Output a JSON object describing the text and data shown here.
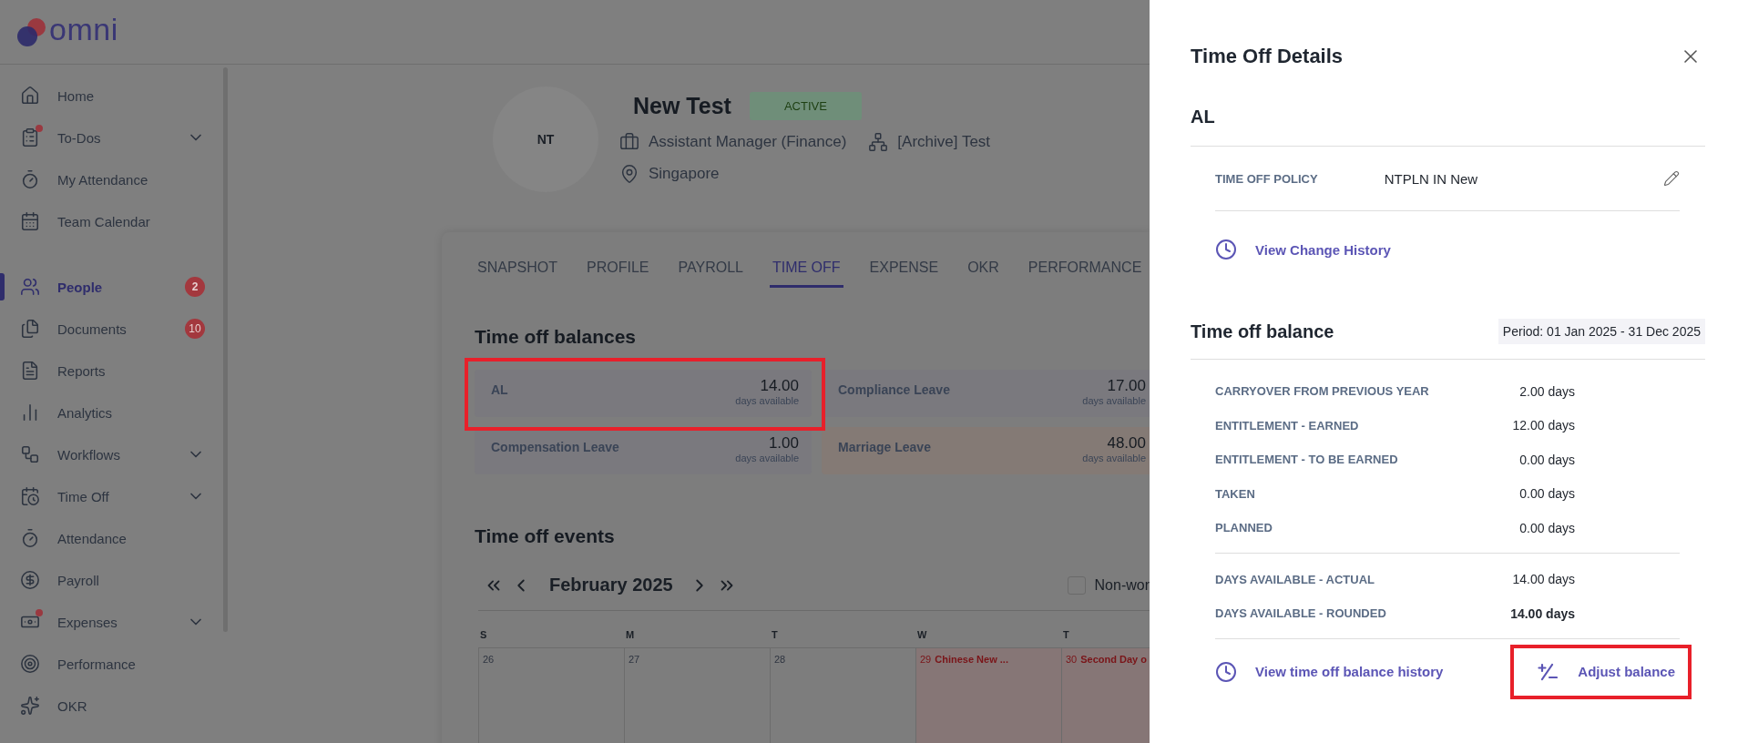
{
  "app": {
    "logo_text": "omni"
  },
  "sidebar": {
    "sections": [
      {
        "items": [
          {
            "label": "Home",
            "selected": false,
            "expandable": false,
            "notification": false
          },
          {
            "label": "To-Dos",
            "selected": false,
            "expandable": true,
            "notification": true
          },
          {
            "label": "My Attendance",
            "selected": false,
            "expandable": false,
            "notification": false
          },
          {
            "label": "Team Calendar",
            "selected": false,
            "expandable": false,
            "notification": false
          }
        ]
      },
      {
        "items": [
          {
            "label": "People",
            "selected": true,
            "expandable": false,
            "notification": false,
            "badge": "2"
          },
          {
            "label": "Documents",
            "selected": false,
            "expandable": false,
            "notification": false,
            "badge": "10"
          },
          {
            "label": "Reports",
            "selected": false,
            "expandable": false,
            "notification": false
          },
          {
            "label": "Analytics",
            "selected": false,
            "expandable": false,
            "notification": false
          },
          {
            "label": "Workflows",
            "selected": false,
            "expandable": true,
            "notification": false
          },
          {
            "label": "Time Off",
            "selected": false,
            "expandable": true,
            "notification": false
          },
          {
            "label": "Attendance",
            "selected": false,
            "expandable": false,
            "notification": false
          },
          {
            "label": "Payroll",
            "selected": false,
            "expandable": false,
            "notification": false
          },
          {
            "label": "Expenses",
            "selected": false,
            "expandable": true,
            "notification": true
          },
          {
            "label": "Performance",
            "selected": false,
            "expandable": false,
            "notification": false
          },
          {
            "label": "OKR",
            "selected": false,
            "expandable": false,
            "notification": false
          }
        ]
      }
    ]
  },
  "profile": {
    "initials": "NT",
    "name": "New Test",
    "status": "ACTIVE",
    "job_title": "Assistant Manager (Finance)",
    "department": "[Archive] Test",
    "location": "Singapore"
  },
  "tabs": [
    {
      "label": "SNAPSHOT",
      "selected": false
    },
    {
      "label": "PROFILE",
      "selected": false
    },
    {
      "label": "PAYROLL",
      "selected": false
    },
    {
      "label": "TIME OFF",
      "selected": true
    },
    {
      "label": "EXPENSE",
      "selected": false
    },
    {
      "label": "OKR",
      "selected": false
    },
    {
      "label": "PERFORMANCE",
      "selected": false
    }
  ],
  "balances": {
    "title": "Time off balances",
    "cards": [
      {
        "name": "AL",
        "amount": "14.00",
        "unit": "days available",
        "color": "#7a797e",
        "highlighted": true
      },
      {
        "name": "Compliance Leave",
        "amount": "17.00",
        "unit": "days available",
        "color": "#7a797e",
        "highlighted": false
      },
      {
        "name": "Compensation Leave",
        "amount": "1.00",
        "unit": "days available",
        "color": "#7a797e",
        "highlighted": false
      },
      {
        "name": "Marriage Leave",
        "amount": "48.00",
        "unit": "days available",
        "color": "#847a75",
        "highlighted": false
      }
    ]
  },
  "events": {
    "title": "Time off events",
    "month": "February 2025",
    "non_working": {
      "label": "Non-wor",
      "checked": false
    },
    "weekdays": [
      "S",
      "M",
      "T",
      "W",
      "T"
    ],
    "days": [
      {
        "day": "26",
        "holiday": false
      },
      {
        "day": "27",
        "holiday": false
      },
      {
        "day": "28",
        "holiday": false
      },
      {
        "day": "29",
        "holiday": true,
        "event": "Chinese New ..."
      },
      {
        "day": "30",
        "holiday": true,
        "event": "Second Day o"
      }
    ]
  },
  "drawer": {
    "title": "Time Off Details",
    "leave_type": "AL",
    "policy": {
      "label": "TIME OFF POLICY",
      "value": "NTPLN IN New"
    },
    "change_history_link": "View Change History",
    "balance_title": "Time off balance",
    "period": "Period: 01 Jan 2025 - 31 Dec 2025",
    "breakdown": [
      {
        "label": "CARRYOVER FROM PREVIOUS YEAR",
        "value": "2.00 days"
      },
      {
        "label": "ENTITLEMENT - EARNED",
        "value": "12.00 days"
      },
      {
        "label": "ENTITLEMENT - TO BE EARNED",
        "value": "0.00 days"
      },
      {
        "label": "TAKEN",
        "value": "0.00 days"
      },
      {
        "label": "PLANNED",
        "value": "0.00 days"
      }
    ],
    "availability": [
      {
        "label": "DAYS AVAILABLE - ACTUAL",
        "value": "14.00 days",
        "emphasized": false
      },
      {
        "label": "DAYS AVAILABLE - ROUNDED",
        "value": "14.00 days",
        "emphasized": true
      }
    ],
    "history_link": "View time off balance history",
    "adjust": {
      "label": "Adjust balance",
      "highlighted": true
    }
  }
}
